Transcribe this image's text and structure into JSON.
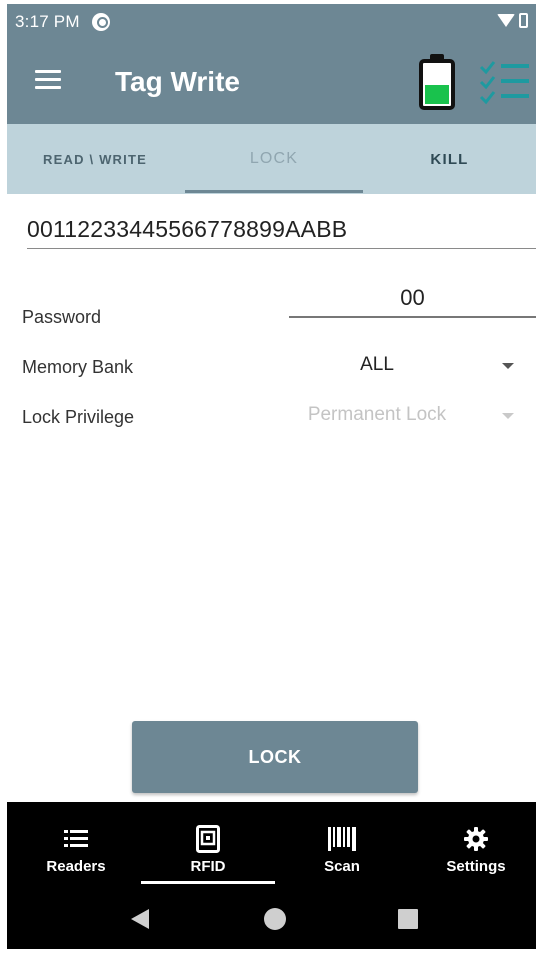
{
  "status_bar": {
    "time": "3:17 PM",
    "icons": [
      "app-status-icon",
      "wifi-icon",
      "battery-status-icon"
    ]
  },
  "app_bar": {
    "title": "Tag Write",
    "icons": [
      "menu-icon",
      "reader-battery-icon",
      "checklist-icon"
    ],
    "battery_level": 0.45,
    "battery_color": "#19c24d"
  },
  "tabs": [
    {
      "label": "READ \\ WRITE",
      "selected": false
    },
    {
      "label": "LOCK",
      "selected": true
    },
    {
      "label": "KILL",
      "selected": false
    }
  ],
  "form": {
    "tag_id": "0011223344556677889 9AABB",
    "password_label": "Password",
    "password_value": "00",
    "memory_bank_label": "Memory Bank",
    "memory_bank_value": "ALL",
    "lock_privilege_label": "Lock Privilege",
    "lock_privilege_value": "Permanent Lock"
  },
  "lock_button": {
    "label": "LOCK"
  },
  "bottom_nav": [
    {
      "label": "Readers",
      "icon": "list-icon",
      "selected": false
    },
    {
      "label": "RFID",
      "icon": "rfid-icon",
      "selected": true
    },
    {
      "label": "Scan",
      "icon": "barcode-icon",
      "selected": false
    },
    {
      "label": "Settings",
      "icon": "gear-icon",
      "selected": false
    }
  ],
  "colors": {
    "primary": "#6d8794",
    "tab_bar": "#bed3db",
    "accent": "#1e9aa0",
    "nav_background": "#000000"
  }
}
